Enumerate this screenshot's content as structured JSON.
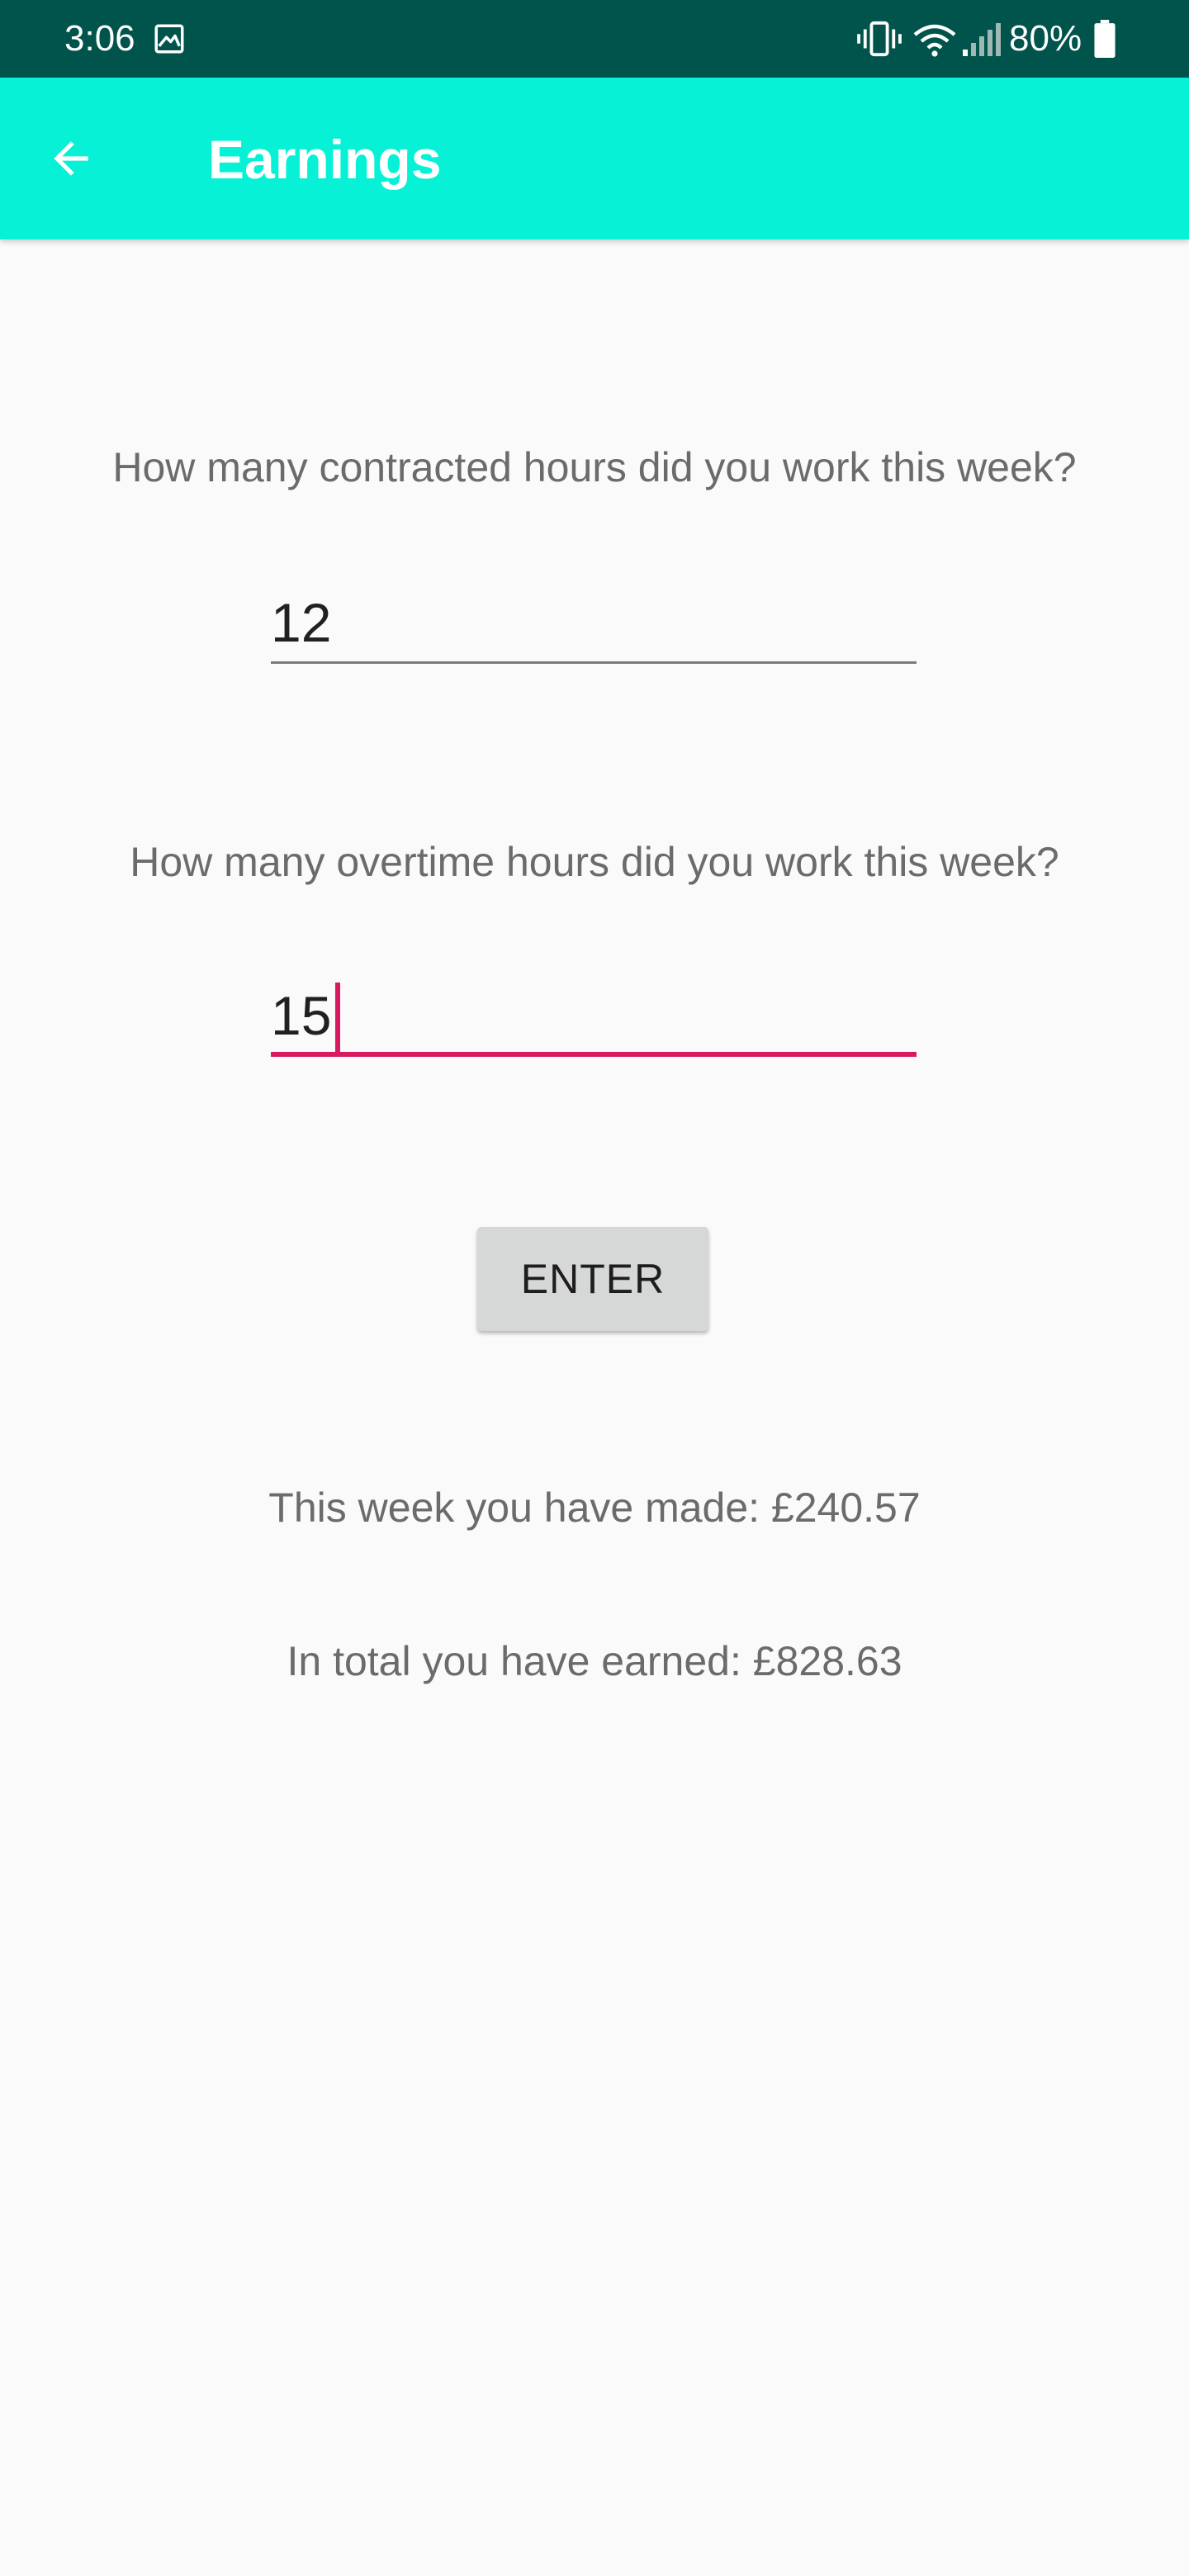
{
  "status_bar": {
    "time": "3:06",
    "battery": "80%",
    "icons": [
      "image-icon",
      "vibrate-icon",
      "wifi-icon",
      "signal-icon",
      "battery-icon"
    ]
  },
  "app_bar": {
    "title": "Earnings",
    "back_icon": "arrow-back-icon",
    "background_color": "#06f1d5"
  },
  "form": {
    "contracted_question": "How many contracted hours did you work this week?",
    "contracted_value": "12",
    "overtime_question": "How many overtime hours did you work this week?",
    "overtime_value": "15",
    "enter_label": "ENTER",
    "focused_field": "overtime",
    "accent_color": "#d81b60"
  },
  "results": {
    "week_text": "This week you have made: £240.57",
    "total_text": "In total you have earned: £828.63"
  }
}
